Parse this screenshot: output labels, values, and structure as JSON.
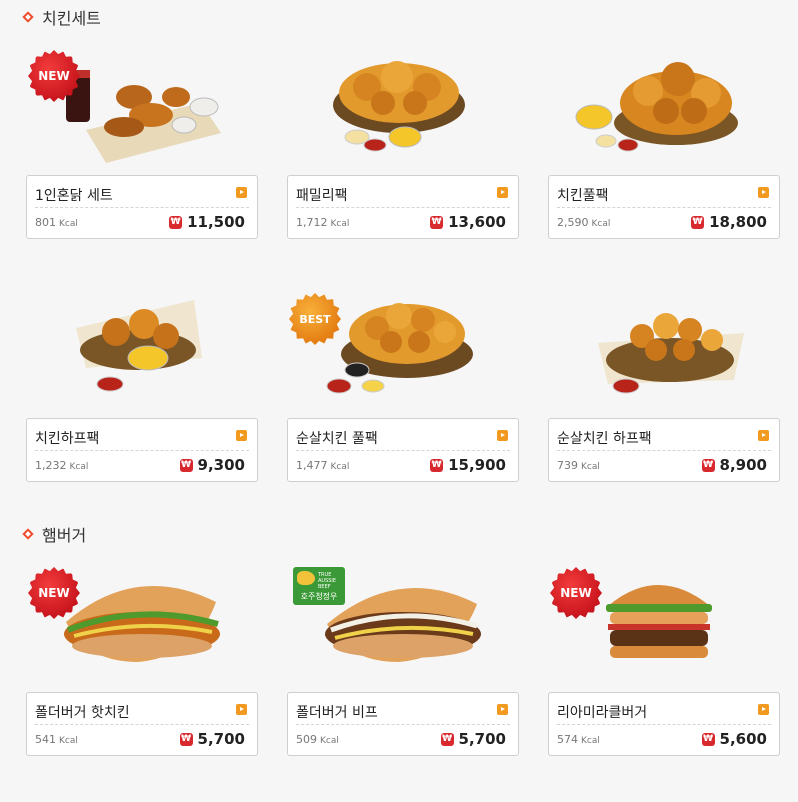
{
  "sections": [
    {
      "title": "치킨세트"
    },
    {
      "title": "햄버거"
    }
  ],
  "items": [
    {
      "name": "1인혼닭 세트",
      "kcal": "801",
      "price": "11,500",
      "badge": "NEW",
      "image": "chicken-set-with-cola-photo"
    },
    {
      "name": "패밀리팩",
      "kcal": "1,712",
      "price": "13,600",
      "image": "chicken-basket-photo"
    },
    {
      "name": "치킨풀팩",
      "kcal": "2,590",
      "price": "18,800",
      "image": "chicken-basket-photo"
    },
    {
      "name": "치킨하프팩",
      "kcal": "1,232",
      "price": "9,300",
      "image": "chicken-basket-photo"
    },
    {
      "name": "순살치킨 풀팩",
      "kcal": "1,477",
      "price": "15,900",
      "badge": "BEST",
      "image": "boneless-chicken-basket-photo"
    },
    {
      "name": "순살치킨 하프팩",
      "kcal": "739",
      "price": "8,900",
      "image": "boneless-chicken-basket-photo"
    },
    {
      "name": "폴더버거 핫치킨",
      "kcal": "541",
      "price": "5,700",
      "badge": "NEW",
      "image": "folder-burger-photo"
    },
    {
      "name": "폴더버거 비프",
      "kcal": "509",
      "price": "5,700",
      "badge_text": "호주청정우",
      "badge_small": "TRUE AUSSIE BEEF",
      "image": "folder-burger-photo"
    },
    {
      "name": "리아미라클버거",
      "kcal": "574",
      "price": "5,600",
      "badge": "NEW",
      "image": "burger-photo"
    }
  ],
  "labels": {
    "kcal_unit": "Kcal",
    "won_symbol": "₩"
  },
  "colors": {
    "accent": "#f04a2a",
    "arrow": "#f29a1f",
    "price_icon": "#d8292f",
    "new_badge": "#c8151d",
    "best_badge": "#e47d12"
  }
}
